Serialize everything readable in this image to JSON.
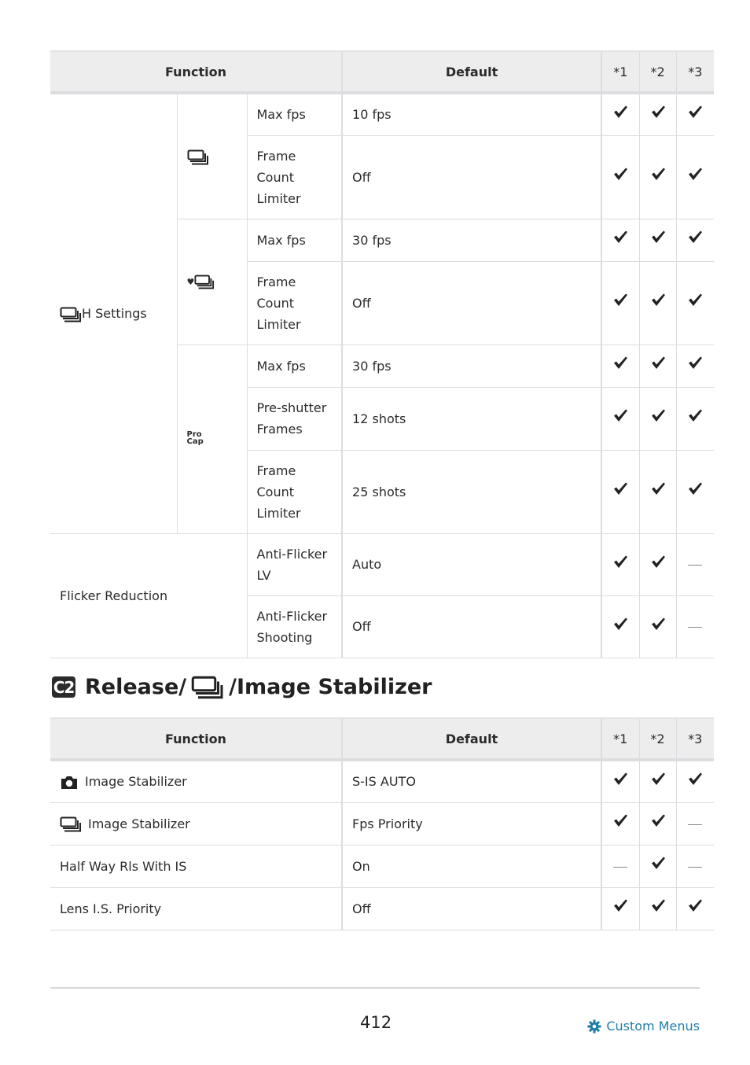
{
  "table1": {
    "headers": {
      "function": "Function",
      "default": "Default",
      "c1": "*1",
      "c2": "*2",
      "c3": "*3"
    },
    "h_settings_label": "H Settings",
    "groups": [
      {
        "icon": "sequential-shooting-icon",
        "rows": [
          {
            "name": "Max fps",
            "default": "10 fps",
            "marks": [
              "check",
              "check",
              "check"
            ]
          },
          {
            "name": "Frame Count Limiter",
            "default": "Off",
            "marks": [
              "check",
              "check",
              "check"
            ]
          }
        ]
      },
      {
        "icon": "silent-sequential-shooting-icon",
        "rows": [
          {
            "name": "Max fps",
            "default": "30 fps",
            "marks": [
              "check",
              "check",
              "check"
            ]
          },
          {
            "name": "Frame Count Limiter",
            "default": "Off",
            "marks": [
              "check",
              "check",
              "check"
            ]
          }
        ]
      },
      {
        "icon": "pro-capture-icon",
        "icon_text": [
          "Pro",
          "Cap"
        ],
        "rows": [
          {
            "name": "Max fps",
            "default": "30 fps",
            "marks": [
              "check",
              "check",
              "check"
            ]
          },
          {
            "name": "Pre-shutter Frames",
            "default": "12 shots",
            "marks": [
              "check",
              "check",
              "check"
            ]
          },
          {
            "name": "Frame Count Limiter",
            "default": "25 shots",
            "marks": [
              "check",
              "check",
              "check"
            ]
          }
        ]
      }
    ],
    "flicker_label": "Flicker Reduction",
    "flicker_rows": [
      {
        "name": "Anti-Flicker LV",
        "default": "Auto",
        "marks": [
          "check",
          "check",
          "dash"
        ]
      },
      {
        "name": "Anti-Flicker Shooting",
        "default": "Off",
        "marks": [
          "check",
          "check",
          "dash"
        ]
      }
    ]
  },
  "section": {
    "badge": "C2",
    "title_part1": "Release/",
    "title_part2": "/Image Stabilizer"
  },
  "table2": {
    "headers": {
      "function": "Function",
      "default": "Default",
      "c1": "*1",
      "c2": "*2",
      "c3": "*3"
    },
    "rows": [
      {
        "icon": "camera-icon",
        "name": "Image Stabilizer",
        "default": "S-IS AUTO",
        "marks": [
          "check",
          "check",
          "check"
        ]
      },
      {
        "icon": "sequential-shooting-icon",
        "name": "Image Stabilizer",
        "default": "Fps Priority",
        "marks": [
          "check",
          "check",
          "dash"
        ]
      },
      {
        "icon": "",
        "name": "Half Way Rls With IS",
        "default": "On",
        "marks": [
          "dash",
          "check",
          "dash"
        ]
      },
      {
        "icon": "",
        "name": "Lens I.S. Priority",
        "default": "Off",
        "marks": [
          "check",
          "check",
          "check"
        ]
      }
    ]
  },
  "footer": {
    "page_number": "412",
    "link_label": "Custom Menus",
    "link_color": "#1f7ea8"
  }
}
